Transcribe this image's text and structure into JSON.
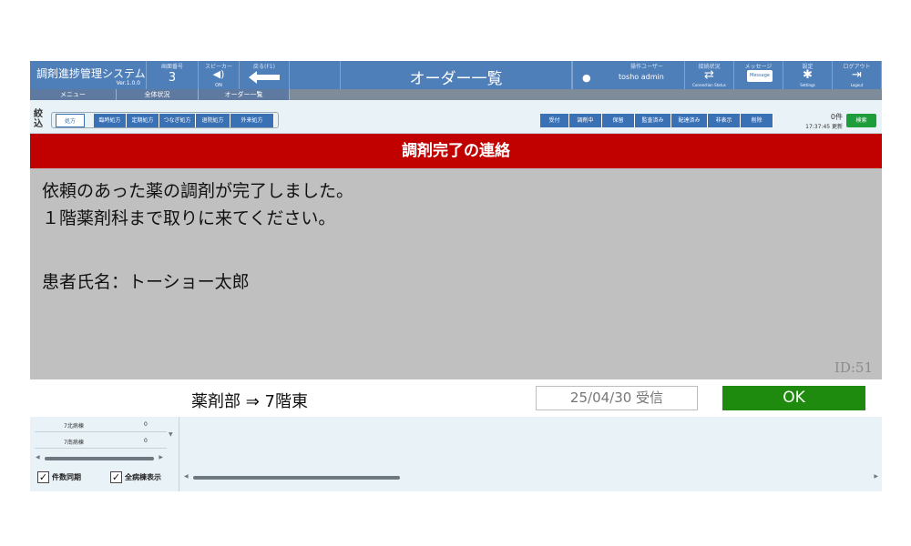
{
  "header": {
    "system_name": "調剤進捗管理システム",
    "version": "Ver.1.0.0",
    "screen_no_label": "画面番号",
    "screen_no": "3",
    "speaker_label": "スピーカー",
    "speaker_state": "ON",
    "back_label": "戻る(F1)",
    "title": "オーダー一覧",
    "operator_label": "操作ユーザー",
    "operator_name": "tosho admin",
    "connection_label": "接続状況",
    "connection_sub": "Connection Status",
    "message_label": "メッセージ",
    "message_btn": "Message",
    "settings_label": "設定",
    "settings_sub": "Settings",
    "logout_label": "ログアウト",
    "logout_sub": "Logout"
  },
  "breadcrumb": [
    "メニュー",
    "全体状況",
    "オーダー一覧"
  ],
  "filter": {
    "label": "絞込",
    "rx_types": [
      "処方",
      "臨時処方",
      "定期処方",
      "つなぎ処方",
      "退院処方",
      "外来処方"
    ],
    "status_buttons": [
      "受付",
      "調剤中",
      "保留",
      "監査済み",
      "配達済み",
      "非表示",
      "削除"
    ],
    "count": "0件",
    "update_time": "17:37:45 更新",
    "search_label": "検索"
  },
  "ward_panel": {
    "rows": [
      {
        "ward": "7北病棟",
        "count": "0"
      },
      {
        "ward": "7南病棟",
        "count": "0"
      }
    ],
    "sync_label": "件数同期",
    "show_all_label": "全病棟表示"
  },
  "modal": {
    "title": "調剤完了の連絡",
    "line1": "依頼のあった薬の調剤が完了しました。",
    "line2": "１階薬剤科まで取りに来てください。",
    "patient": "患者氏名：トーショー太郎",
    "id": "ID:51",
    "route": "薬剤部 ⇒ 7階東",
    "received": "25/04/30 受信",
    "ok_label": "OK"
  },
  "colors": {
    "header_bg": "#4f7fb9",
    "alert_red": "#c10000",
    "ok_green": "#1e8a0e",
    "body_gray": "#c0c0c0"
  }
}
